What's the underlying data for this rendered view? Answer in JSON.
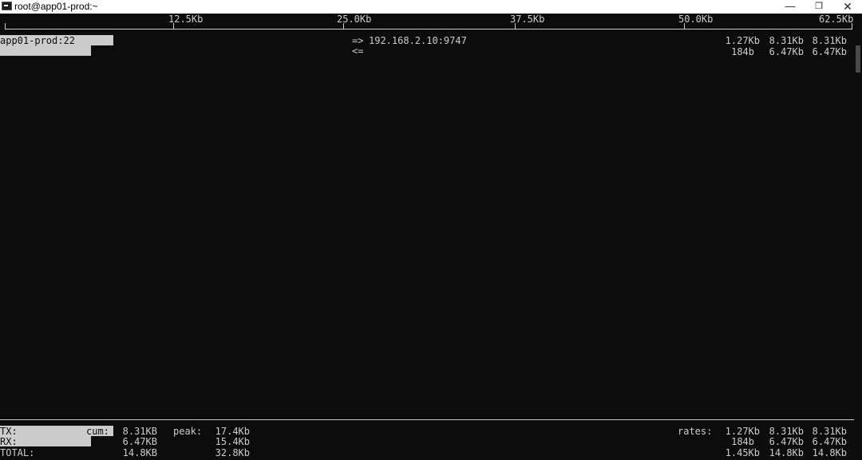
{
  "window": {
    "title": "root@app01-prod:~",
    "minimize_glyph": "—",
    "maximize_glyph": "❐",
    "close_glyph": "✕"
  },
  "scale": {
    "ticks": [
      "12.5Kb",
      "25.0Kb",
      "37.5Kb",
      "50.0Kb",
      "62.5Kb"
    ]
  },
  "connection": {
    "host": "app01-prod:22",
    "send_arrow": "=>",
    "recv_arrow": "<=",
    "peer": "192.168.2.10:9747",
    "tx_rates": [
      "1.27Kb",
      "8.31Kb",
      "8.31Kb"
    ],
    "rx_rates": [
      "184b",
      "6.47Kb",
      "6.47Kb"
    ]
  },
  "totals": {
    "tx_label": "TX:",
    "rx_label": "RX:",
    "total_label": "TOTAL:",
    "cum_label": "cum:",
    "peak_label": "peak:",
    "rates_label": "rates:",
    "tx_cum": "8.31KB",
    "rx_cum": "6.47KB",
    "total_cum": "14.8KB",
    "tx_peak": "17.4Kb",
    "rx_peak": "15.4Kb",
    "total_peak": "32.8Kb",
    "tx_rates": [
      "1.27Kb",
      "8.31Kb",
      "8.31Kb"
    ],
    "rx_rates": [
      "184b",
      "6.47Kb",
      "6.47Kb"
    ],
    "total_rates": [
      "1.45Kb",
      "14.8Kb",
      "14.8Kb"
    ]
  },
  "bars": {
    "conn_tx_fraction": 0.133,
    "conn_rx_fraction": 0.107,
    "total_tx_fraction": 0.133,
    "total_rx_fraction": 0.107
  }
}
